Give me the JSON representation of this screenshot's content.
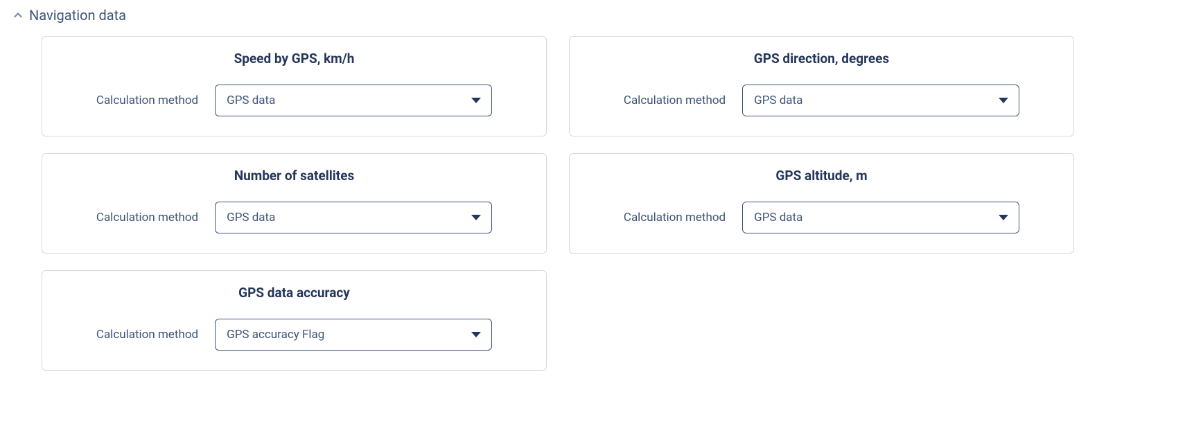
{
  "section": {
    "title": "Navigation data"
  },
  "cards": {
    "speed": {
      "title": "Speed by GPS, km/h",
      "field_label": "Calculation method",
      "value": "GPS data"
    },
    "direction": {
      "title": "GPS direction, degrees",
      "field_label": "Calculation method",
      "value": "GPS data"
    },
    "satellites": {
      "title": "Number of satellites",
      "field_label": "Calculation method",
      "value": "GPS data"
    },
    "altitude": {
      "title": "GPS altitude, m",
      "field_label": "Calculation method",
      "value": "GPS data"
    },
    "accuracy": {
      "title": "GPS data accuracy",
      "field_label": "Calculation method",
      "value": "GPS accuracy Flag"
    }
  }
}
